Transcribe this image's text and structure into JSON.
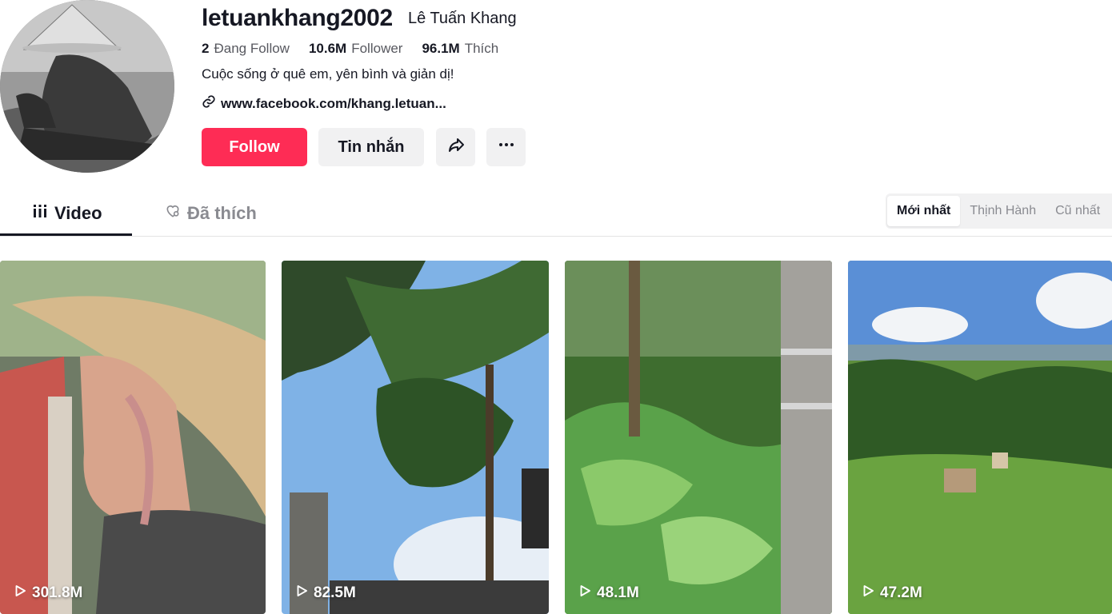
{
  "profile": {
    "username": "letuankhang2002",
    "nickname": "Lê Tuấn Khang",
    "stats": [
      {
        "value": "2",
        "label": "Đang Follow"
      },
      {
        "value": "10.6M",
        "label": "Follower"
      },
      {
        "value": "96.1M",
        "label": "Thích"
      }
    ],
    "bio": "Cuộc sống ở quê em, yên bình và giản dị!",
    "link": "www.facebook.com/khang.letuan..."
  },
  "actions": {
    "follow_label": "Follow",
    "message_label": "Tin nhắn",
    "share_icon": "share-icon",
    "more_icon": "more-icon"
  },
  "tabs": [
    {
      "label": "Video",
      "icon": "grid-icon",
      "active": true
    },
    {
      "label": "Đã thích",
      "icon": "liked-heart-icon",
      "active": false
    }
  ],
  "sort": [
    {
      "label": "Mới nhất",
      "active": true
    },
    {
      "label": "Thịnh Hành",
      "active": false
    },
    {
      "label": "Cũ nhất",
      "active": false
    }
  ],
  "videos": [
    {
      "views": "301.8M"
    },
    {
      "views": "82.5M"
    },
    {
      "views": "48.1M"
    },
    {
      "views": "47.2M"
    }
  ],
  "colors": {
    "brand": "#fe2c55",
    "text": "#161823",
    "secondary": "#f1f1f2"
  }
}
